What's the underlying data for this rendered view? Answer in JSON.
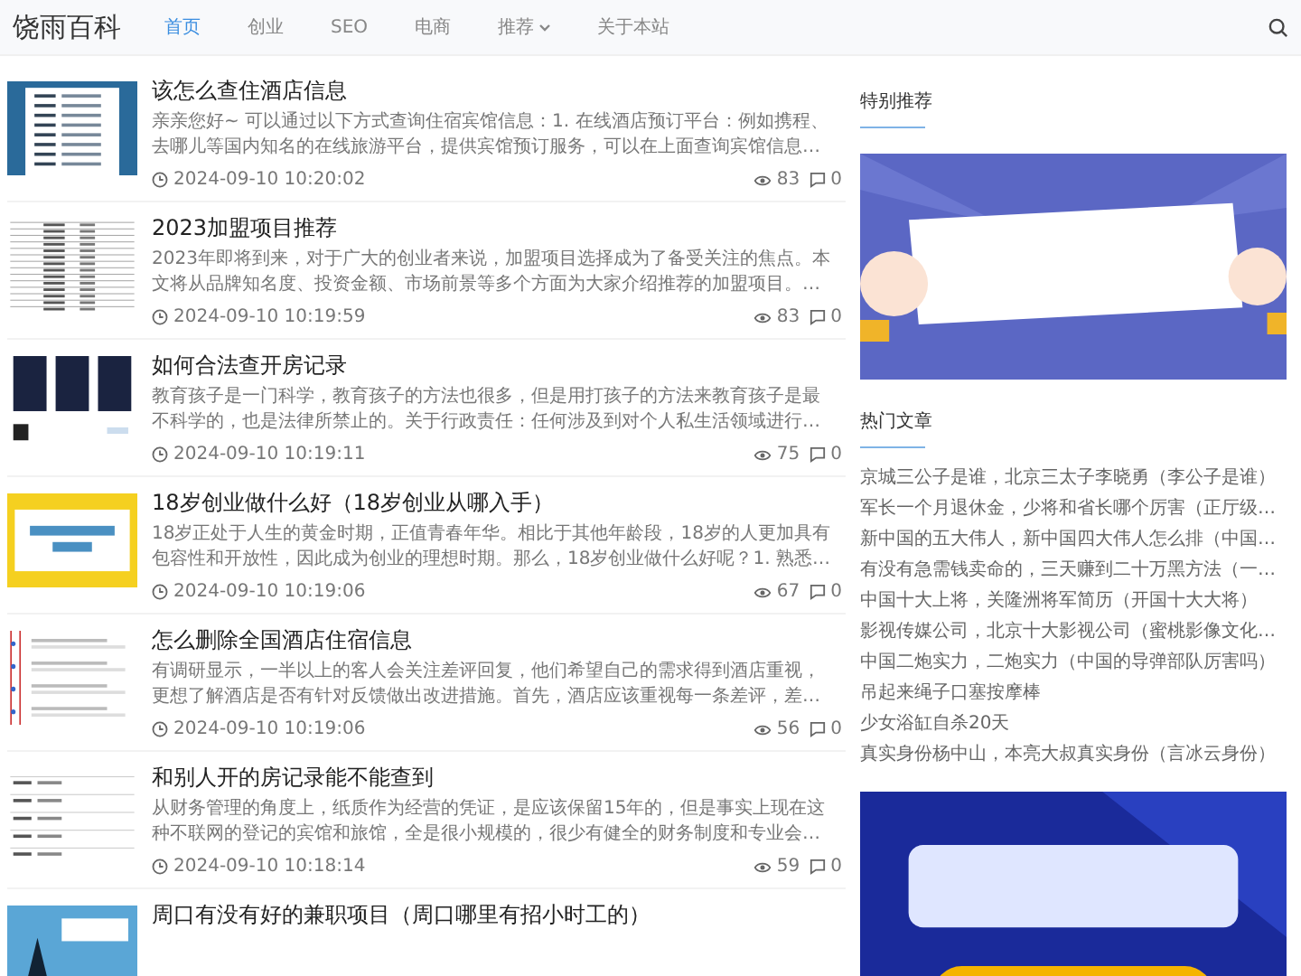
{
  "site": {
    "logo": "饶雨百科"
  },
  "nav": [
    {
      "label": "首页",
      "selected": true,
      "dropdown": false
    },
    {
      "label": "创业",
      "selected": false,
      "dropdown": false
    },
    {
      "label": "SEO",
      "selected": false,
      "dropdown": false
    },
    {
      "label": "电商",
      "selected": false,
      "dropdown": false
    },
    {
      "label": "推荐",
      "selected": false,
      "dropdown": true
    },
    {
      "label": "关于本站",
      "selected": false,
      "dropdown": false
    }
  ],
  "articles": [
    {
      "title": "该怎么查住酒店信息",
      "summary_lines": [
        "亲亲您好~ 可以通过以下方式查询住宿宾馆信息：1. 在线酒店预订平台：例如携程、",
        "去哪儿等国内知名的在线旅游平台，提供宾馆预订服务，可以在上面查询宾馆信息…"
      ],
      "time": "2024-09-10 10:20:02",
      "views": "83",
      "comments": "0"
    },
    {
      "title": "2023加盟项目推荐",
      "summary_lines": [
        "2023年即将到来，对于广大的创业者来说，加盟项目选择成为了备受关注的焦点。本",
        "文将从品牌知名度、投资金额、市场前景等多个方面为大家介绍推荐的加盟项目。…"
      ],
      "time": "2024-09-10 10:19:59",
      "views": "83",
      "comments": "0"
    },
    {
      "title": "如何合法查开房记录",
      "summary_lines": [
        "教育孩子是一门科学，教育孩子的方法也很多，但是用打孩子的方法来教育孩子是最",
        "不科学的，也是法律所禁止的。关于行政责任：任何涉及到对个人私生活领域进行…"
      ],
      "time": "2024-09-10 10:19:11",
      "views": "75",
      "comments": "0"
    },
    {
      "title": "18岁创业做什么好（18岁创业从哪入手）",
      "summary_lines": [
        "18岁正处于人生的黄金时期，正值青春年华。相比于其他年龄段，18岁的人更加具有",
        "包容性和开放性，因此成为创业的理想时期。那么，18岁创业做什么好呢？1. 熟悉…"
      ],
      "time": "2024-09-10 10:19:06",
      "views": "67",
      "comments": "0"
    },
    {
      "title": "怎么删除全国酒店住宿信息",
      "summary_lines": [
        "有调研显示，一半以上的客人会关注差评回复，他们希望自己的需求得到酒店重视，",
        "更想了解酒店是否有针对反馈做出改进措施。首先，酒店应该重视每一条差评，差…"
      ],
      "time": "2024-09-10 10:19:06",
      "views": "56",
      "comments": "0"
    },
    {
      "title": "和别人开的房记录能不能查到",
      "summary_lines": [
        "从财务管理的角度上，纸质作为经营的凭证，是应该保留15年的，但是事实上现在这",
        "种不联网的登记的宾馆和旅馆，全是很小规模的，很少有健全的财务制度和专业会…"
      ],
      "time": "2024-09-10 10:18:14",
      "views": "59",
      "comments": "0"
    },
    {
      "title": "周口有没有好的兼职项目（周口哪里有招小时工的）"
    }
  ],
  "sidebar": {
    "featured_title": "特别推荐",
    "hot_title": "热门文章",
    "hot": [
      "京城三公子是谁，北京三太子李晓勇（李公子是谁）",
      "军长一个月退休金，少将和省长哪个厉害（正厅级…",
      "新中国的五大伟人，新中国四大伟人怎么排（中国…",
      "有没有急需钱卖命的，三天赚到二十万黑方法（一…",
      "中国十大上将，关隆洲将军简历（开国十大大将）",
      "影视传媒公司，北京十大影视公司（蜜桃影像文化…",
      "中国二炮实力，二炮实力（中国的导弹部队厉害吗）",
      "吊起来绳子口塞按摩棒",
      "少女浴缸自杀20天",
      "真实身份杨中山，本亮大叔真实身份（言冰云身份）"
    ]
  }
}
